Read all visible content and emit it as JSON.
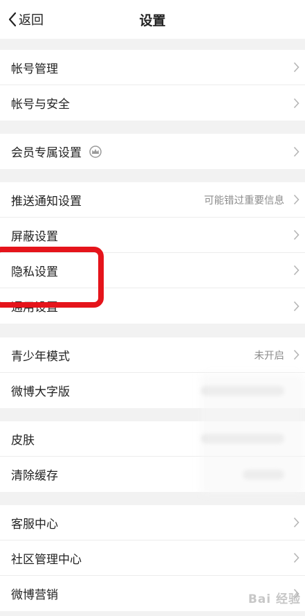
{
  "header": {
    "back_label": "返回",
    "title": "设置"
  },
  "groups": [
    {
      "items": [
        {
          "label": "帐号管理"
        },
        {
          "label": "帐号与安全"
        }
      ]
    },
    {
      "items": [
        {
          "label": "会员专属设置",
          "icon": "crown-icon"
        }
      ]
    },
    {
      "items": [
        {
          "label": "推送通知设置",
          "value": "可能错过重要信息"
        },
        {
          "label": "屏蔽设置"
        },
        {
          "label": "隐私设置"
        },
        {
          "label": "通用设置"
        }
      ]
    },
    {
      "items": [
        {
          "label": "青少年模式",
          "value": "未开启"
        },
        {
          "label": "微博大字版"
        }
      ]
    },
    {
      "items": [
        {
          "label": "皮肤"
        },
        {
          "label": "清除缓存"
        }
      ]
    },
    {
      "items": [
        {
          "label": "客服中心"
        },
        {
          "label": "社区管理中心"
        },
        {
          "label": "微博营销"
        }
      ]
    }
  ],
  "watermark": "Bai 经验",
  "colors": {
    "highlight": "#e5141b",
    "background": "#f2f2f2",
    "secondary_text": "#8c8c8c"
  }
}
